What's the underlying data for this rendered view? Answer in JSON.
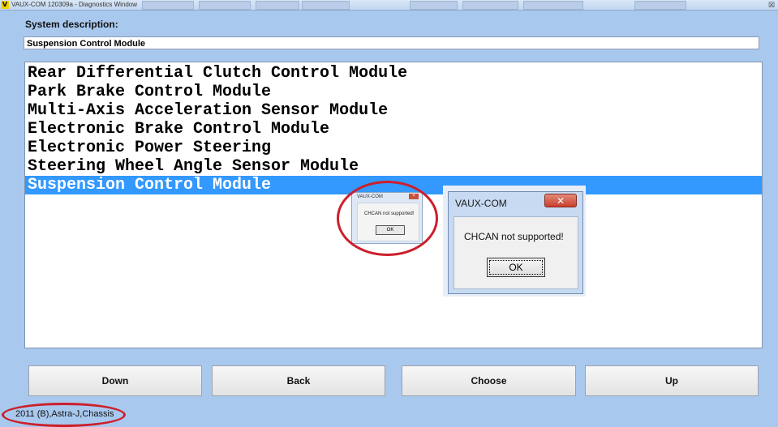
{
  "window": {
    "app_icon": "V",
    "title": "VAUX-COM 120309a - Diagnostics Window",
    "taskbar_items": [
      "",
      "",
      "",
      "",
      "",
      "",
      "",
      ""
    ],
    "close_glyph": "☒"
  },
  "system_description": {
    "label": "System description:",
    "value": "Suspension Control Module"
  },
  "module_list": {
    "items": [
      "Rear Differential Clutch Control Module",
      "Park Brake Control Module",
      "Multi-Axis Acceleration Sensor Module",
      "Electronic Brake Control Module",
      "Electronic Power Steering",
      "Steering Wheel Angle Sensor Module",
      "Suspension Control Module"
    ],
    "selected_index": 6
  },
  "small_dialog": {
    "title": "VAUX-COM",
    "message": "CHCAN not supported!",
    "ok_label": "OK",
    "close_glyph": "×"
  },
  "dialog": {
    "title": "VAUX-COM",
    "message": "CHCAN not supported!",
    "ok_label": "OK",
    "close_glyph": "✕"
  },
  "buttons": {
    "down": "Down",
    "back": "Back",
    "choose": "Choose",
    "up": "Up"
  },
  "status": {
    "vehicle": "2011 (B),Astra-J,Chassis"
  },
  "colors": {
    "background": "#a9c8ee",
    "selection": "#3399ff",
    "annotation_ring": "#cc1f2b"
  }
}
